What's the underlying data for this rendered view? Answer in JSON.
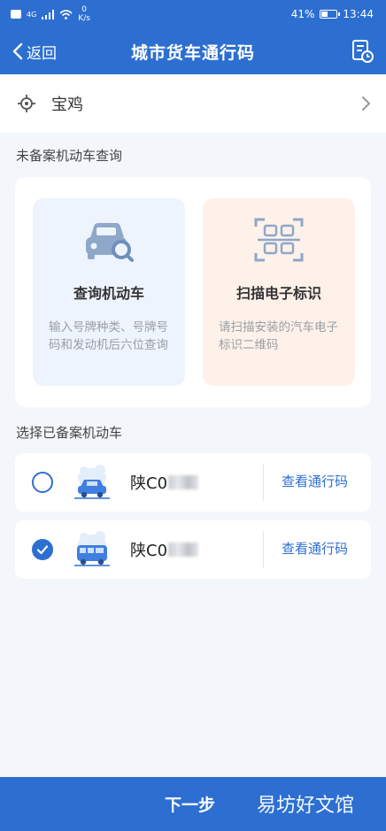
{
  "status_bar": {
    "signal_left": "4G",
    "speed_value": "0",
    "speed_unit": "K/s",
    "battery": "41%",
    "battery_level": 0.41,
    "time": "13:44"
  },
  "nav": {
    "back_label": "返回",
    "title": "城市货车通行码",
    "right_icon": "document-clock-icon"
  },
  "city": {
    "name": "宝鸡",
    "icon": "location-target-icon"
  },
  "unregistered": {
    "section_title": "未备案机动车查询",
    "items": [
      {
        "title": "查询机动车",
        "desc": "输入号牌种类、号牌号码和发动机后六位查询",
        "icon": "car-search-icon"
      },
      {
        "title": "扫描电子标识",
        "desc": "请扫描安装的汽车电子标识二维码",
        "icon": "qr-scan-icon"
      }
    ]
  },
  "registered": {
    "section_title": "选择已备案机动车",
    "vehicles": [
      {
        "plate": "陕C0",
        "checked": false,
        "action": "查看通行码",
        "icon": "car-icon"
      },
      {
        "plate": "陕C0",
        "checked": true,
        "action": "查看通行码",
        "icon": "van-icon"
      }
    ]
  },
  "footer": {
    "next_label": "下一步",
    "watermark": "易坊好文馆"
  },
  "colors": {
    "primary": "#2d6fd1",
    "card_blue": "#eef4fd",
    "card_orange": "#fdf1ea"
  }
}
